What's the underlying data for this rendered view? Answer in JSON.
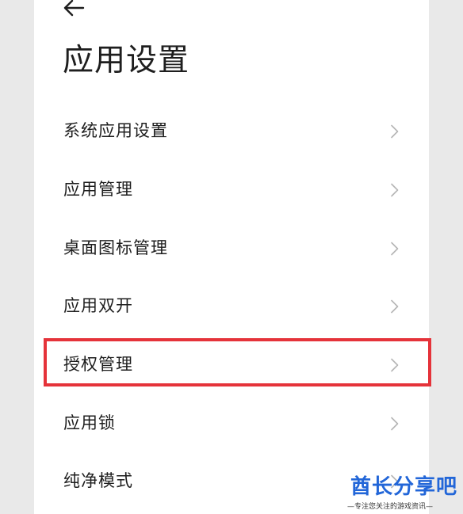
{
  "header": {
    "back_icon": "arrow-left-icon",
    "title": "应用设置"
  },
  "menu": {
    "items": [
      {
        "label": "系统应用设置",
        "icon": "chevron-right-icon"
      },
      {
        "label": "应用管理",
        "icon": "chevron-right-icon"
      },
      {
        "label": "桌面图标管理",
        "icon": "chevron-right-icon"
      },
      {
        "label": "应用双开",
        "icon": "chevron-right-icon"
      },
      {
        "label": "授权管理",
        "icon": "chevron-right-icon",
        "highlighted": true
      },
      {
        "label": "应用锁",
        "icon": "chevron-right-icon"
      },
      {
        "label": "纯净模式",
        "icon": "chevron-right-icon"
      }
    ]
  },
  "annotation": {
    "highlight_color": "#e5333a"
  },
  "watermark": {
    "title": "酋长分享吧",
    "subtitle": "—专注您关注的游戏资讯—",
    "color": "#2266d8"
  },
  "colors": {
    "text": "#1e1e1e",
    "chevron": "#b5b5b5",
    "background": "#ffffff",
    "outer_background": "#e9e9e9"
  }
}
